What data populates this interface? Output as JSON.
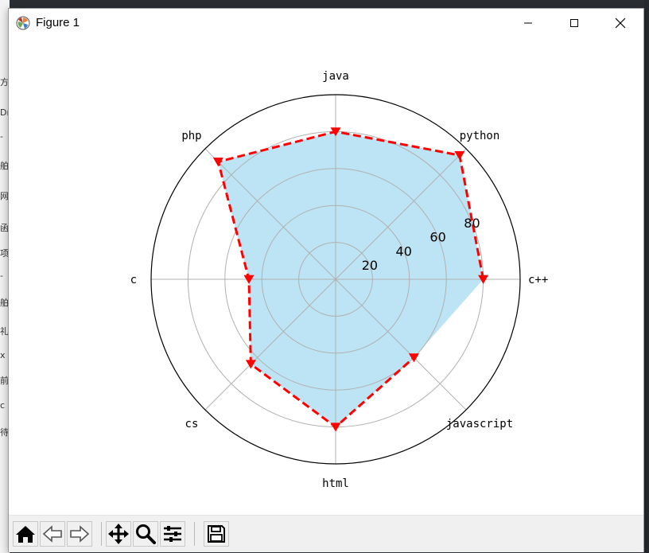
{
  "window": {
    "title": "Figure 1"
  },
  "chart_data": {
    "type": "radar",
    "categories": [
      "c++",
      "python",
      "java",
      "php",
      "c",
      "cs",
      "html",
      "javascript"
    ],
    "values": [
      80,
      95,
      80,
      90,
      47,
      65,
      80,
      60
    ],
    "rlim": [
      0,
      100
    ],
    "rticks": [
      20,
      40,
      60,
      80
    ],
    "grid": true,
    "fill_closed_to_first": false,
    "series_style": {
      "line_color": "#ff0000",
      "line_style": "dashed",
      "marker": "triangle-down",
      "fill_color": "#87ceeb",
      "fill_alpha": 0.55
    }
  },
  "toolbar": {
    "buttons": [
      "home-icon",
      "back-icon",
      "forward-icon",
      "pan-icon",
      "zoom-icon",
      "configure-icon",
      "save-icon"
    ]
  },
  "background": {
    "left_edge_glyphs": [
      "方",
      "Dr",
      "-",
      "舶",
      "网",
      "函",
      "项",
      "-",
      "舶",
      "礼",
      "x",
      "前",
      "c",
      "待"
    ]
  }
}
